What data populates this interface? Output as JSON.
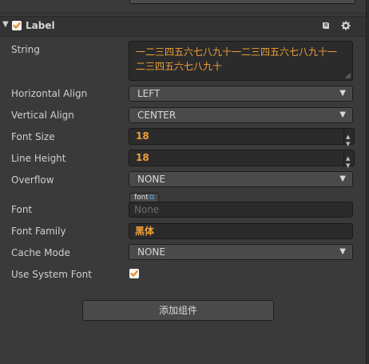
{
  "component": {
    "title": "Label",
    "enabled": true
  },
  "properties": {
    "string": {
      "label": "String",
      "value": "一二三四五六七八九十一二三四五六七八九十一二三四五六七八九十"
    },
    "horizontal_align": {
      "label": "Horizontal Align",
      "value": "LEFT"
    },
    "vertical_align": {
      "label": "Vertical Align",
      "value": "CENTER"
    },
    "font_size": {
      "label": "Font Size",
      "value": "18"
    },
    "line_height": {
      "label": "Line Height",
      "value": "18"
    },
    "overflow": {
      "label": "Overflow",
      "value": "NONE"
    },
    "font": {
      "label": "Font",
      "asset_type": "font",
      "value": "None"
    },
    "font_family": {
      "label": "Font Family",
      "value": "黑体"
    },
    "cache_mode": {
      "label": "Cache Mode",
      "value": "NONE"
    },
    "use_system_font": {
      "label": "Use System Font",
      "checked": true
    }
  },
  "add_component_button": "添加组件",
  "icons": {
    "collapse": "triangle-down-icon",
    "help": "book-icon",
    "settings": "gear-icon",
    "select_arrow": "triangle-down-icon",
    "open_asset": "external-link-icon"
  },
  "colors": {
    "accent": "#f0a038",
    "background": "#3a3a3a",
    "link": "#4aa6e8"
  }
}
